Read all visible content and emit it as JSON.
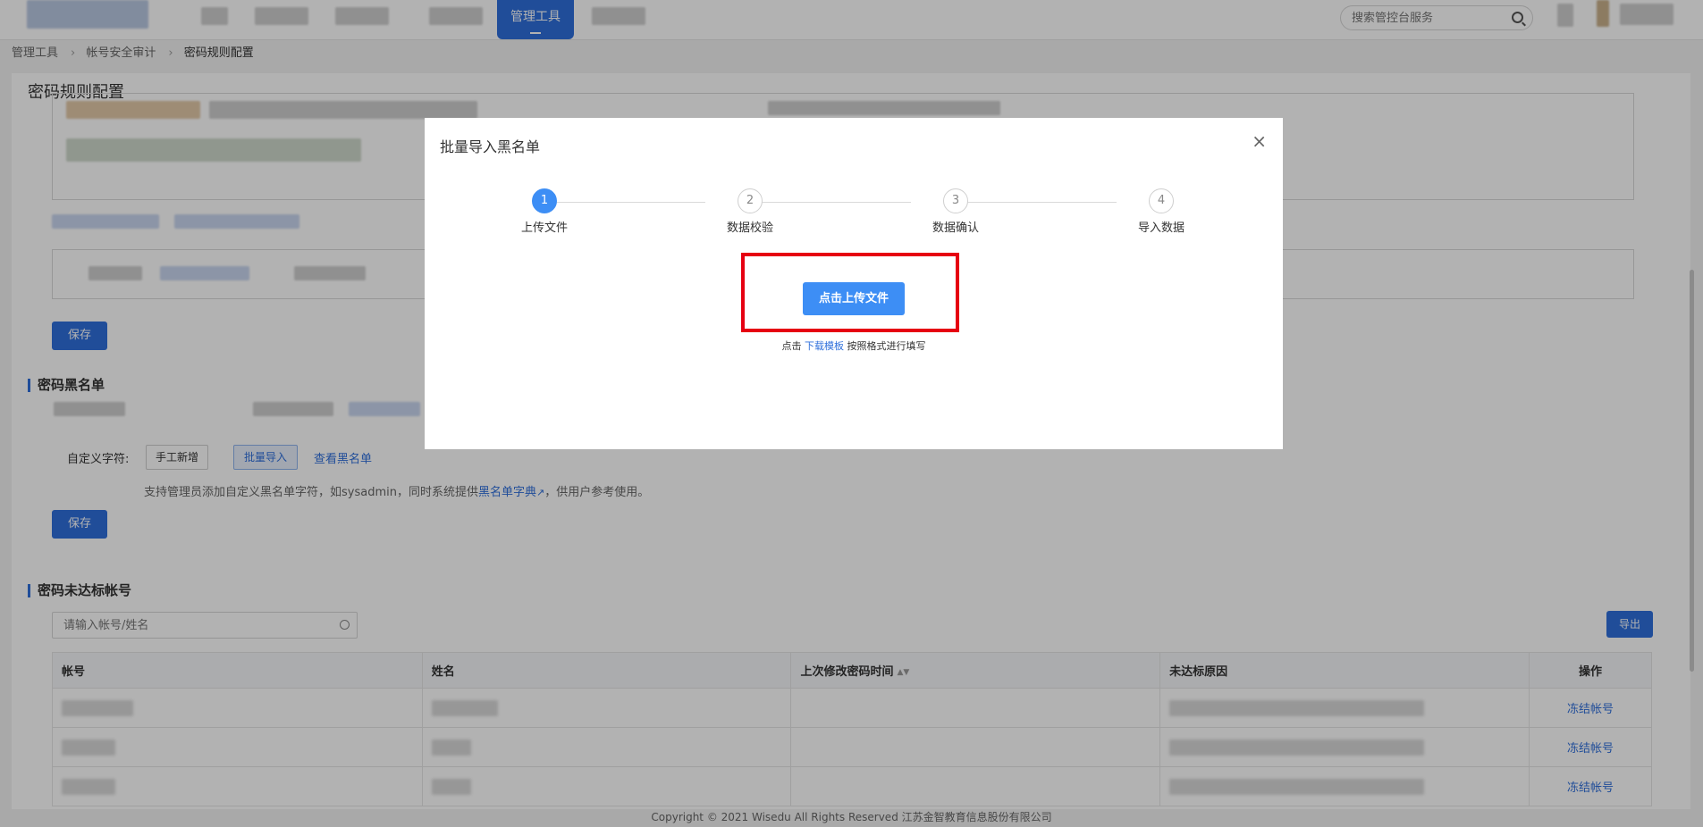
{
  "nav": {
    "active_item": "管理工具",
    "search_placeholder": "搜索管控台服务"
  },
  "breadcrumb": [
    "管理工具",
    "帐号安全审计",
    "密码规则配置"
  ],
  "page": {
    "title": "密码规则配置",
    "save_label": "保存"
  },
  "blacklist": {
    "section_title": "密码黑名单",
    "custom_label": "自定义字符:",
    "manual_add": "手工新增",
    "batch_import": "批量导入",
    "view_blacklist": "查看黑名单",
    "hint_prefix": "支持管理员添加自定义黑名单字符，如sysadmin，同时系统提供",
    "hint_link": "黑名单字典",
    "hint_suffix": "，供用户参考使用。",
    "save_label": "保存"
  },
  "noncompliant": {
    "section_title": "密码未达标帐号",
    "search_placeholder": "请输入帐号/姓名",
    "export_label": "导出",
    "columns": [
      "帐号",
      "姓名",
      "上次修改密码时间",
      "未达标原因",
      "操作"
    ],
    "row_action": "冻结帐号",
    "row_count": 3
  },
  "footer": "Copyright © 2021 Wisedu All Rights Reserved 江苏金智教育信息股份有限公司",
  "modal": {
    "title": "批量导入黑名单",
    "close_symbol": "×",
    "steps": [
      {
        "number": "1",
        "label": "上传文件",
        "active": true
      },
      {
        "number": "2",
        "label": "数据校验",
        "active": false
      },
      {
        "number": "3",
        "label": "数据确认",
        "active": false
      },
      {
        "number": "4",
        "label": "导入数据",
        "active": false
      }
    ],
    "upload_button": "点击上传文件",
    "hint_prefix": "点击",
    "hint_link": "下载模板",
    "hint_suffix": "按照格式进行填写"
  },
  "colors": {
    "primary": "#2f6fdb",
    "step_active": "#3d8ef5",
    "highlight": "#e60012"
  }
}
